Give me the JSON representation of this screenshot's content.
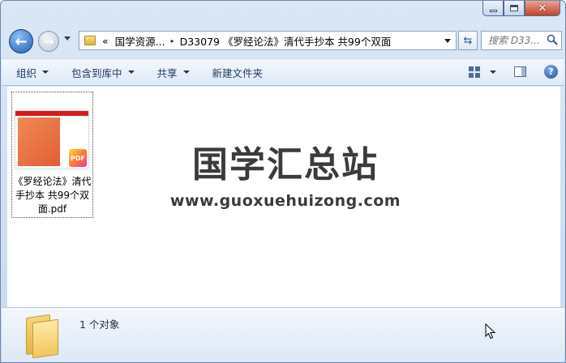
{
  "nav": {
    "back_label": "←",
    "forward_label": "→"
  },
  "address": {
    "overflow_label": "«",
    "segments": [
      "国学资源...",
      "D33079 《罗经论法》清代手抄本 共99个双面"
    ],
    "separator": "▸"
  },
  "search": {
    "placeholder": "搜索 D33..."
  },
  "toolbar": {
    "organize": "组织",
    "include_in_library": "包含到库中",
    "share": "共享",
    "new_folder": "新建文件夹",
    "help": "?"
  },
  "files": [
    {
      "name": "《罗经论法》清代手抄本 共99个双面.pdf",
      "thumbnail_badge": "PDF"
    }
  ],
  "watermark": {
    "title": "国学汇总站",
    "url": "www.guoxuehuizong.com"
  },
  "details": {
    "count_text": "1 个对象"
  },
  "colors": {
    "accent": "#1f5db3",
    "toolbar_bg": "#dde9f7",
    "close_button": "#c5432a"
  }
}
